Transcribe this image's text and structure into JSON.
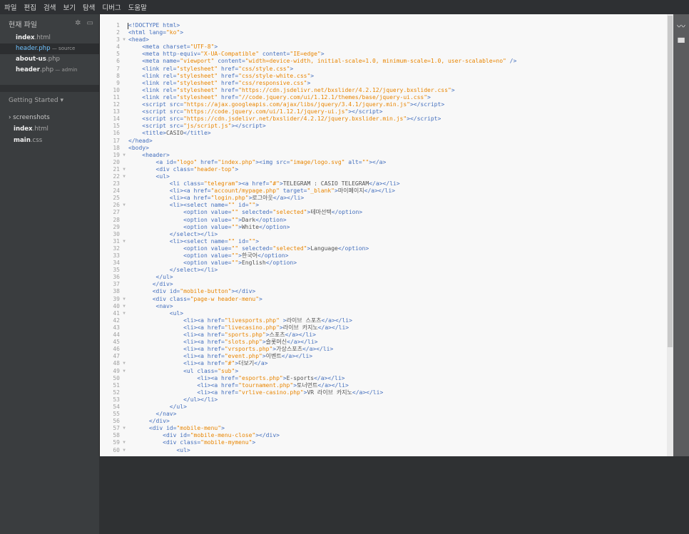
{
  "menu": [
    "파일",
    "편집",
    "검색",
    "보기",
    "탐색",
    "디버그",
    "도움말"
  ],
  "sidebar": {
    "working_files_title": "현재 파일",
    "working_files": [
      {
        "base": "index",
        "ext": ".html",
        "suffix": "",
        "active": false
      },
      {
        "base": "header",
        "ext": ".php",
        "suffix": " — source",
        "active": true
      },
      {
        "base": "about-us",
        "ext": ".php",
        "suffix": "",
        "active": false
      },
      {
        "base": "header",
        "ext": ".php",
        "suffix": " — admin",
        "active": false
      }
    ],
    "project_title": "Getting Started ▾",
    "tree": [
      {
        "type": "folder",
        "label": "› screenshots"
      },
      {
        "type": "file",
        "base": "index",
        "ext": ".html"
      },
      {
        "type": "file",
        "base": "main",
        "ext": ".css"
      }
    ]
  },
  "editor": {
    "lines": [
      {
        "t": "<!DOCTYPE html>",
        "f": false
      },
      {
        "t": "<html lang=\"ko\">",
        "f": false
      },
      {
        "t": "<head>",
        "f": true
      },
      {
        "t": "    <meta charset=\"UTF-8\">",
        "f": false
      },
      {
        "t": "    <meta http-equiv=\"X-UA-Compatible\" content=\"IE=edge\">",
        "f": false
      },
      {
        "t": "    <meta name=\"viewport\" content=\"width=device-width, initial-scale=1.0, minimum-scale=1.0, user-scalable=no\" />",
        "f": false
      },
      {
        "t": "    <link rel=\"stylesheet\" href=\"css/style.css\">",
        "f": false
      },
      {
        "t": "    <link rel=\"stylesheet\" href=\"css/style-white.css\">",
        "f": false
      },
      {
        "t": "    <link rel=\"stylesheet\" href=\"css/responsive.css\">",
        "f": false
      },
      {
        "t": "    <link rel=\"stylesheet\" href=\"https://cdn.jsdelivr.net/bxslider/4.2.12/jquery.bxslider.css\">",
        "f": false
      },
      {
        "t": "    <link rel=\"stylesheet\" href=\"//code.jquery.com/ui/1.12.1/themes/base/jquery-ui.css\">",
        "f": false
      },
      {
        "t": "    <script src=\"https://ajax.googleapis.com/ajax/libs/jquery/3.4.1/jquery.min.js\"></script>",
        "f": false
      },
      {
        "t": "    <script src=\"https://code.jquery.com/ui/1.12.1/jquery-ui.js\"></script>",
        "f": false
      },
      {
        "t": "    <script src=\"https://cdn.jsdelivr.net/bxslider/4.2.12/jquery.bxslider.min.js\"></script>",
        "f": false
      },
      {
        "t": "    <script src=\"js/script.js\"></script>",
        "f": false
      },
      {
        "t": "    <title>CASIO</title>",
        "f": false
      },
      {
        "t": "</head>",
        "f": false
      },
      {
        "t": "<body>",
        "f": false
      },
      {
        "t": "    <header>",
        "f": true
      },
      {
        "t": "        <a id=\"logo\" href=\"index.php\"><img src=\"image/logo.svg\" alt=\"\"></a>",
        "f": false
      },
      {
        "t": "        <div class=\"header-top\">",
        "f": true
      },
      {
        "t": "        <ul>",
        "f": true
      },
      {
        "t": "            <li class=\"telegram\"><a href=\"#\">TELEGRAM : CASIO TELEGRAM</a></li>",
        "f": false
      },
      {
        "t": "            <li><a href=\"account/mypage.php\" target=\"_blank\">마이페이지</a></li>",
        "f": false
      },
      {
        "t": "            <li><a href=\"login.php\">로그아웃</a></li>",
        "f": false
      },
      {
        "t": "            <li><select name=\"\" id=\"\">",
        "f": true
      },
      {
        "t": "                <option value=\"\" selected=\"selected\">테마선택</option>",
        "f": false
      },
      {
        "t": "                <option value=\"\">Dark</option>",
        "f": false
      },
      {
        "t": "                <option value=\"\">White</option>",
        "f": false
      },
      {
        "t": "            </select></li>",
        "f": false
      },
      {
        "t": "            <li><select name=\"\" id=\"\">",
        "f": true
      },
      {
        "t": "                <option value=\"\" selected=\"selected\">Language</option>",
        "f": false
      },
      {
        "t": "                <option value=\"\">한국어</option>",
        "f": false
      },
      {
        "t": "                <option value=\"\">English</option>",
        "f": false
      },
      {
        "t": "            </select></li>",
        "f": false
      },
      {
        "t": "        </ul>",
        "f": false
      },
      {
        "t": "       </div>",
        "f": false
      },
      {
        "t": "       <div id=\"mobile-button\"></div>",
        "f": false
      },
      {
        "t": "       <div class=\"page-w header-menu\">",
        "f": true
      },
      {
        "t": "        <nav>",
        "f": true
      },
      {
        "t": "            <ul>",
        "f": true
      },
      {
        "t": "                <li><a href=\"livesports.php\" >라이브 스포츠</a></li>",
        "f": false
      },
      {
        "t": "                <li><a href=\"livecasino.php\">라이브 카지노</a></li>",
        "f": false
      },
      {
        "t": "                <li><a href=\"sports.php\">스포츠</a></li>",
        "f": false
      },
      {
        "t": "                <li><a href=\"slots.php\">슬롯머신</a></li>",
        "f": false
      },
      {
        "t": "                <li><a href=\"vrsports.php\">가상스포츠</a></li>",
        "f": false
      },
      {
        "t": "                <li><a href=\"event.php\">이벤트</a></li>",
        "f": false
      },
      {
        "t": "                <li><a href=\"#\">더보기</a>",
        "f": true
      },
      {
        "t": "                <ul class=\"sub\">",
        "f": true
      },
      {
        "t": "                    <li><a href=\"esports.php\">E-sports</a></li>",
        "f": false
      },
      {
        "t": "                    <li><a href=\"tournament.php\">토너먼트</a></li>",
        "f": false
      },
      {
        "t": "                    <li><a href=\"vrlive-casino.php\">VR 라이브 카지노</a></li>",
        "f": false
      },
      {
        "t": "                </ul></li>",
        "f": false
      },
      {
        "t": "            </ul>",
        "f": false
      },
      {
        "t": "        </nav>",
        "f": false
      },
      {
        "t": "      </div>",
        "f": false
      },
      {
        "t": "      <div id=\"mobile-menu\">",
        "f": true
      },
      {
        "t": "          <div id=\"mobile-menu-close\"></div>",
        "f": false
      },
      {
        "t": "          <div class=\"mobile-mymenu\">",
        "f": true
      },
      {
        "t": "              <ul>",
        "f": true
      }
    ]
  },
  "right_toolbar": [
    {
      "icon": "live-preview-icon",
      "glyph": "〰"
    },
    {
      "icon": "extension-manager-icon",
      "glyph": "▀"
    }
  ]
}
